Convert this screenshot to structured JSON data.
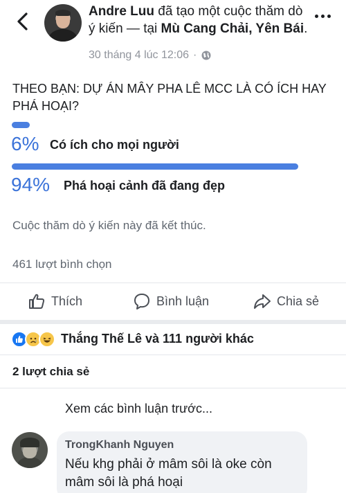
{
  "post": {
    "author": "Andre Luu",
    "action_text": " đã tạo một cuộc thăm dò ý kiến — tại ",
    "location": "Mù Cang Chải, Yên Bái",
    "location_suffix": ".",
    "timestamp": "30 tháng 4 lúc 12:06",
    "audience_icon": "globe-icon"
  },
  "poll": {
    "question": "THEO BẠN: DỰ ÁN MÂY PHA LÊ MCC LÀ CÓ ÍCH HAY PHÁ HOẠI?",
    "options": [
      {
        "percent_label": "6%",
        "percent": 6,
        "label": "Có ích cho mọi người"
      },
      {
        "percent_label": "94%",
        "percent": 94,
        "label": "Phá hoại cảnh đã đang đẹp"
      }
    ],
    "ended_text": "Cuộc thăm dò ý kiến này đã kết thúc.",
    "votes_text": "461 lượt bình chọn",
    "bar_color": "#4a7fe0",
    "percent_color": "#3b73d9"
  },
  "actions": {
    "like": "Thích",
    "comment": "Bình luận",
    "share": "Chia sẻ"
  },
  "reactions": {
    "icons": [
      "like-icon",
      "sad-icon",
      "haha-icon"
    ],
    "summary": "Thắng Thế Lê và 111 người khác"
  },
  "shares_text": "2 lượt chia sẻ",
  "comments": {
    "view_previous": "Xem các bình luận trước...",
    "items": [
      {
        "author": "TrongKhanh Nguyen",
        "text": "Nếu khg phải ở mâm sôi là oke còn mâm sôi là phá hoại"
      }
    ]
  },
  "colors": {
    "accent": "#1877f2",
    "secondary_text": "#606770",
    "divider": "#e4e6eb"
  }
}
